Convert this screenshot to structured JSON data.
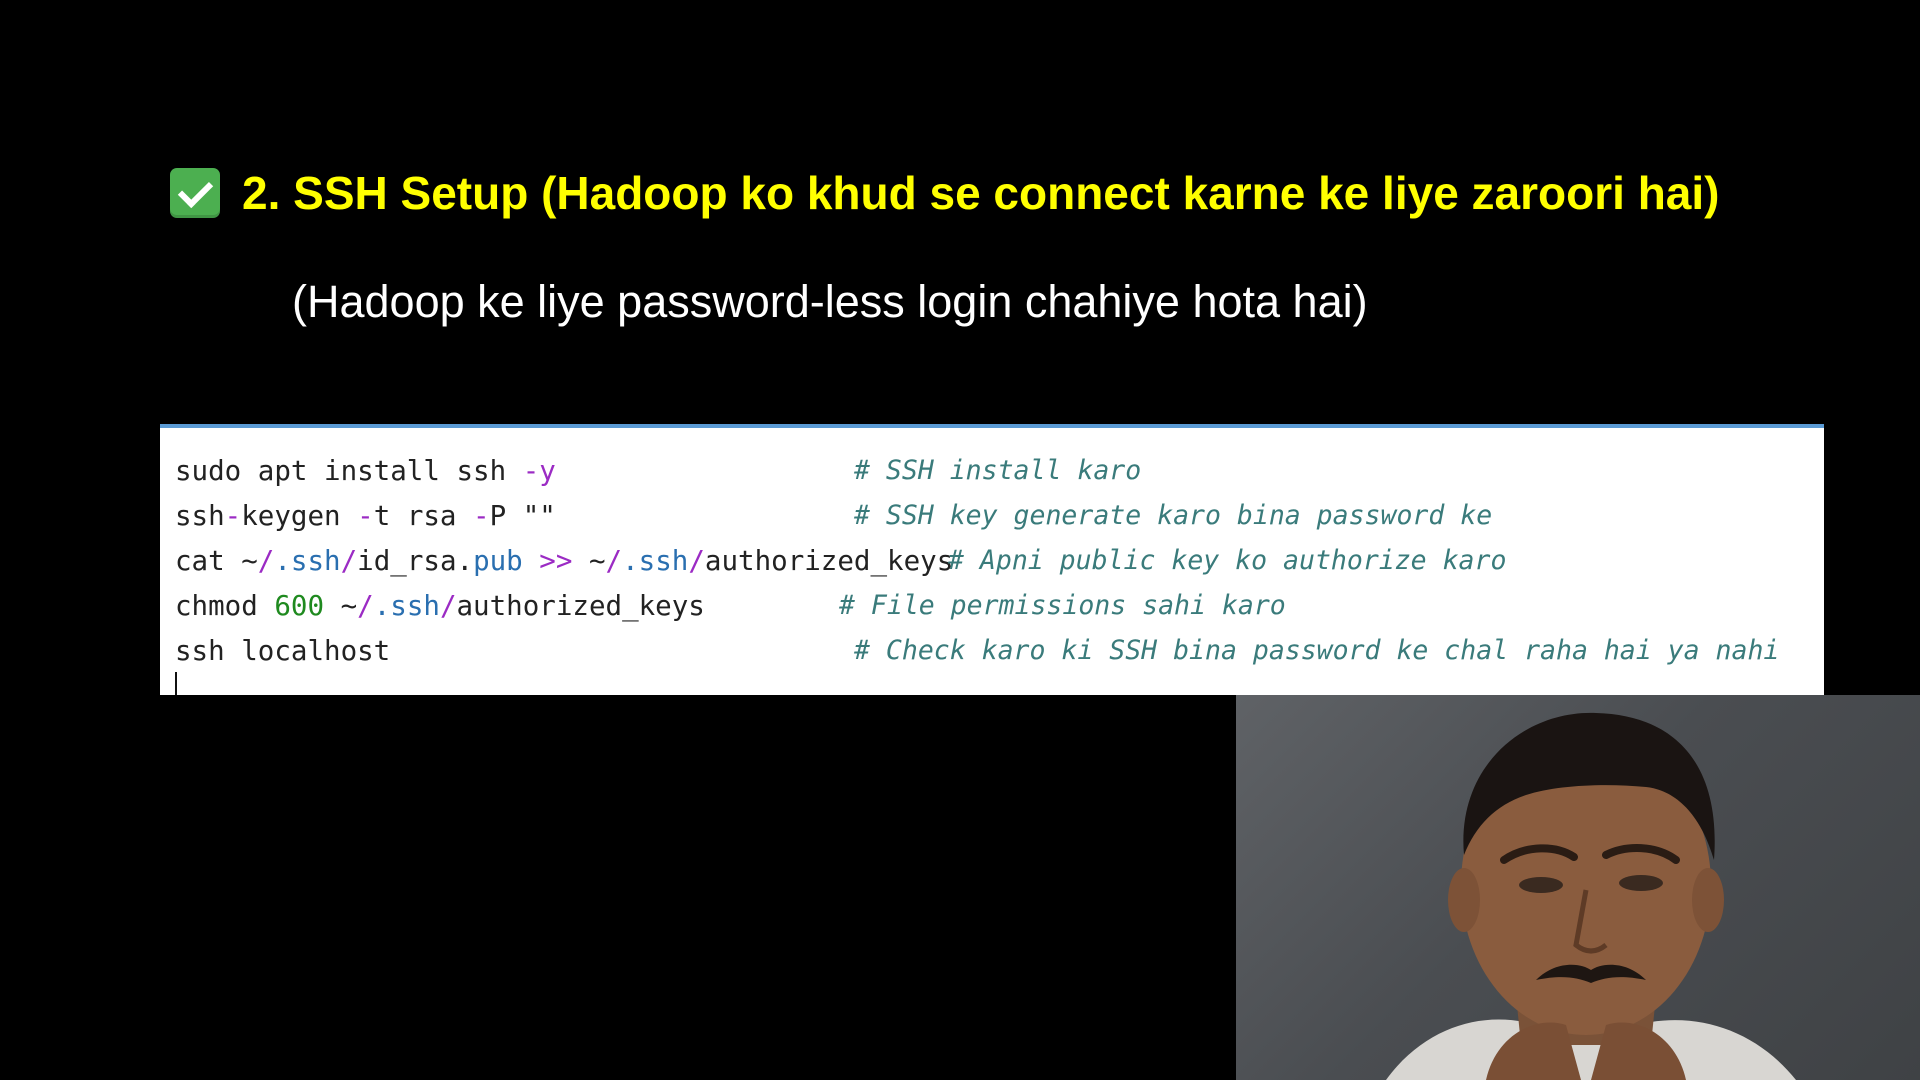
{
  "slide": {
    "heading": "2. SSH Setup (Hadoop ko khud se connect karne ke liye zaroori hai)",
    "subheading": "(Hadoop ke liye password-less login chahiye hota hai)",
    "heading_color": "#ffff00",
    "subheading_color": "#ffffff",
    "background_color": "#000000"
  },
  "code": {
    "lines": [
      {
        "tokens": [
          {
            "text": "sudo apt install ssh ",
            "kind": "plain"
          },
          {
            "text": "-y",
            "kind": "purple"
          }
        ],
        "comment": "# SSH install karo"
      },
      {
        "tokens": [
          {
            "text": "ssh",
            "kind": "plain"
          },
          {
            "text": "-",
            "kind": "purple"
          },
          {
            "text": "keygen ",
            "kind": "plain"
          },
          {
            "text": "-",
            "kind": "purple"
          },
          {
            "text": "t rsa ",
            "kind": "plain"
          },
          {
            "text": "-",
            "kind": "purple"
          },
          {
            "text": "P \"\"",
            "kind": "plain"
          }
        ],
        "comment": "# SSH key generate karo bina password ke"
      },
      {
        "tokens": [
          {
            "text": "cat ~",
            "kind": "plain"
          },
          {
            "text": "/",
            "kind": "purple"
          },
          {
            "text": ".ssh",
            "kind": "blue"
          },
          {
            "text": "/",
            "kind": "purple"
          },
          {
            "text": "id_rsa.",
            "kind": "plain"
          },
          {
            "text": "pub",
            "kind": "blue"
          },
          {
            "text": " ",
            "kind": "plain"
          },
          {
            "text": ">>",
            "kind": "purple"
          },
          {
            "text": " ~",
            "kind": "plain"
          },
          {
            "text": "/",
            "kind": "purple"
          },
          {
            "text": ".ssh",
            "kind": "blue"
          },
          {
            "text": "/",
            "kind": "purple"
          },
          {
            "text": "authorized_keys",
            "kind": "plain"
          }
        ],
        "comment": "# Apni public key ko authorize karo"
      },
      {
        "tokens": [
          {
            "text": "chmod ",
            "kind": "plain"
          },
          {
            "text": "600",
            "kind": "green"
          },
          {
            "text": " ~",
            "kind": "plain"
          },
          {
            "text": "/",
            "kind": "purple"
          },
          {
            "text": ".ssh",
            "kind": "blue"
          },
          {
            "text": "/",
            "kind": "purple"
          },
          {
            "text": "authorized_keys",
            "kind": "plain"
          }
        ],
        "comment": "# File permissions sahi karo"
      },
      {
        "tokens": [
          {
            "text": "ssh localhost",
            "kind": "plain"
          }
        ],
        "comment": "# Check karo ki SSH bina password ke chal raha hai ya nahi"
      }
    ],
    "colors": {
      "plain": "#222222",
      "purple": "#9b2bc4",
      "blue": "#2a6fb0",
      "green": "#1f8a1f",
      "comment": "#3a7b7b",
      "panel_border": "#5b9bd5"
    }
  },
  "icons": {
    "heading_icon": "check-mark-button-icon"
  }
}
